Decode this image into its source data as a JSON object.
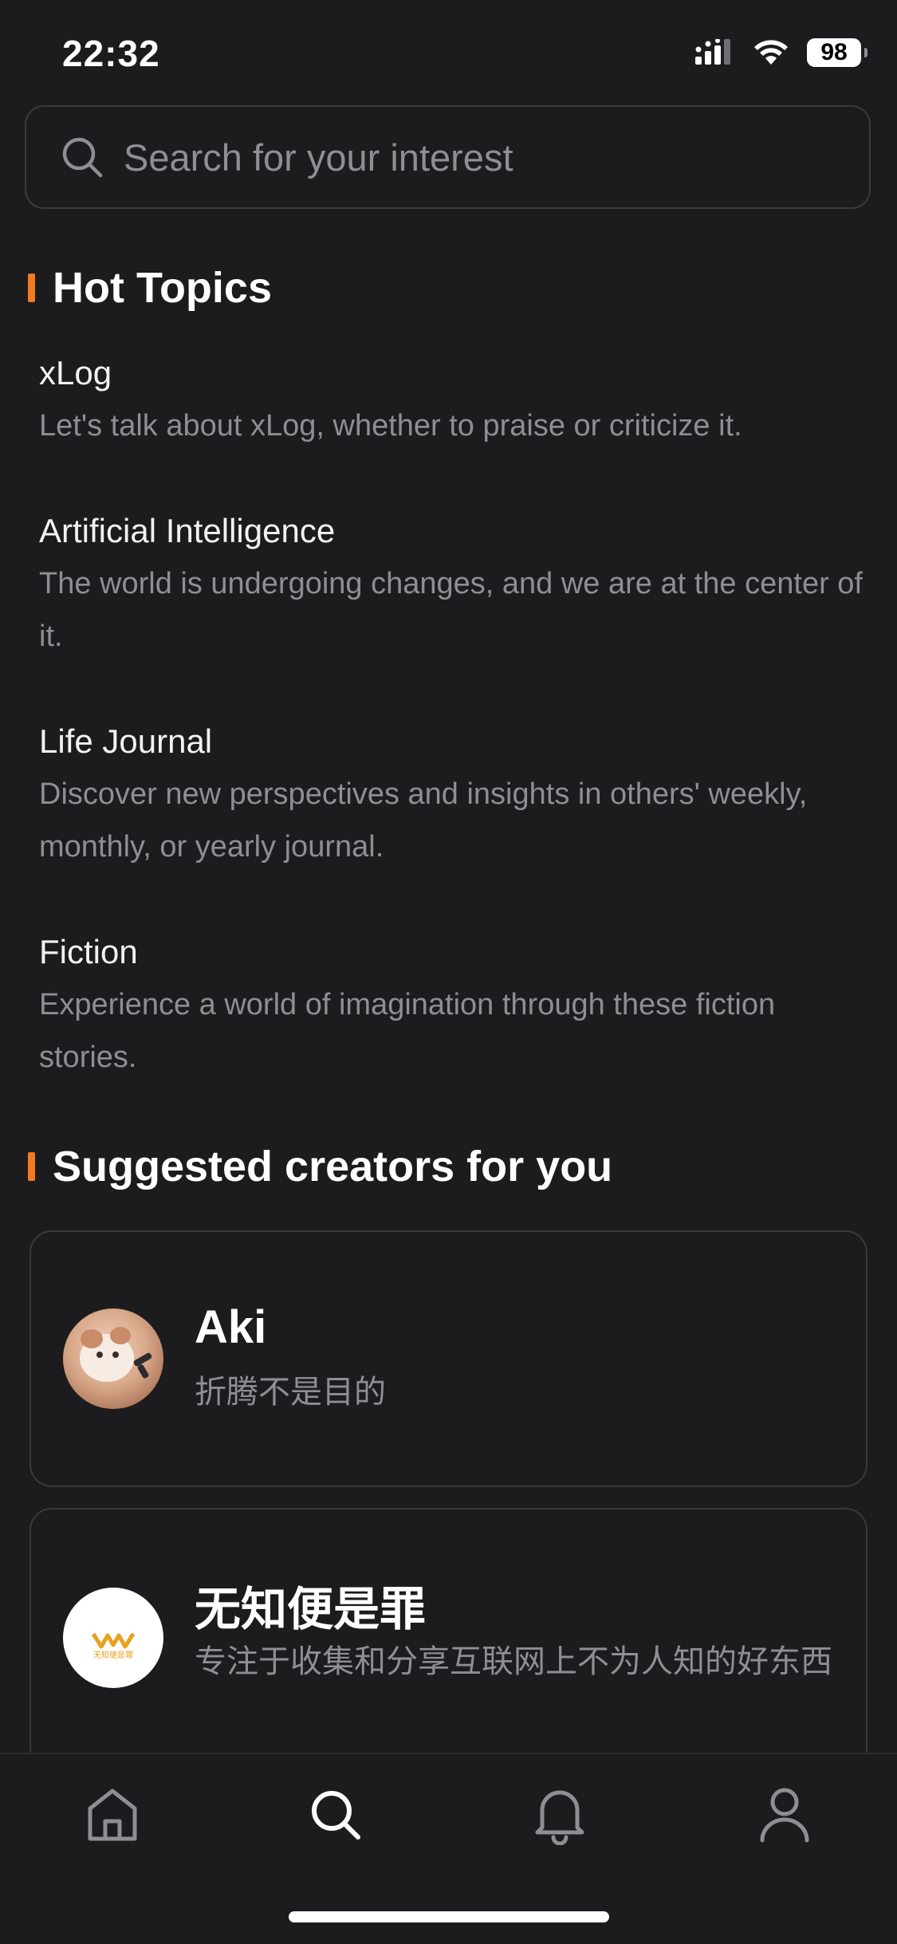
{
  "status_bar": {
    "time": "22:32",
    "battery": "98",
    "icons": [
      "signal-icon",
      "wifi-icon",
      "battery-icon"
    ]
  },
  "search": {
    "placeholder": "Search for your interest"
  },
  "hot_topics": {
    "title": "Hot Topics",
    "items": [
      {
        "title": "xLog",
        "description": "Let's talk about xLog, whether to praise or criticize it."
      },
      {
        "title": "Artificial Intelligence",
        "description": "The world is undergoing changes, and we are at the center of it."
      },
      {
        "title": "Life Journal",
        "description": "Discover new perspectives and insights in others' weekly, monthly, or yearly journal."
      },
      {
        "title": "Fiction",
        "description": "Experience a world of imagination through these fiction stories."
      }
    ]
  },
  "suggested_creators": {
    "title": "Suggested creators for you",
    "items": [
      {
        "name": "Aki",
        "bio": "折腾不是目的"
      },
      {
        "name": "无知便是罪",
        "bio": "专注于收集和分享互联网上不为人知的好东西",
        "avatar_text": "无知便是罪"
      }
    ]
  },
  "tab_bar": {
    "tabs": [
      "home-icon",
      "search-icon",
      "bell-icon",
      "user-icon"
    ],
    "active": "search-icon"
  },
  "colors": {
    "background": "#1c1c1e",
    "accent": "#f47a20",
    "secondary_text": "#8e8e93",
    "border": "#3a3a3c"
  }
}
